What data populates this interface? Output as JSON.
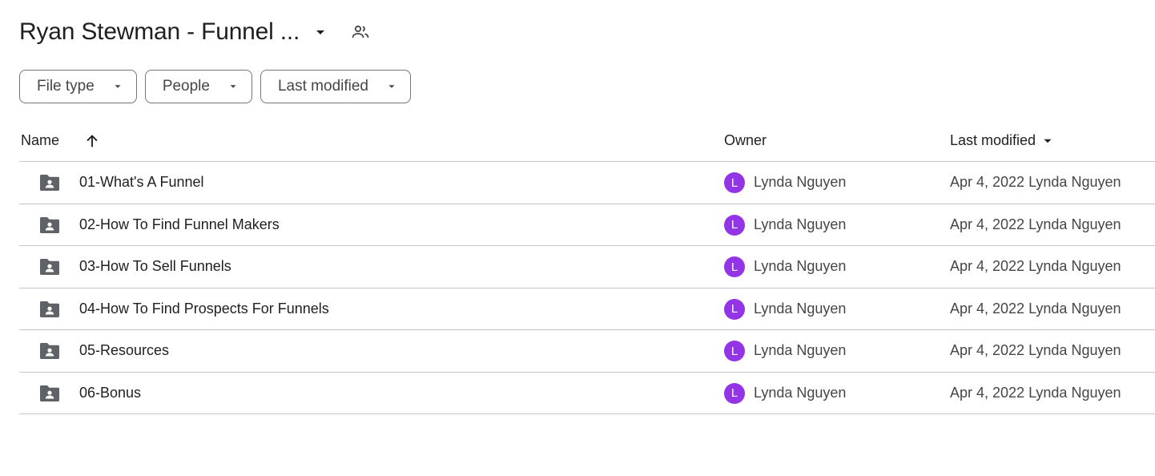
{
  "header": {
    "title": "Ryan Stewman - Funnel ...",
    "icons": {
      "caret": "arrow-drop-down-icon",
      "share": "people-icon"
    }
  },
  "filters": [
    {
      "label": "File type"
    },
    {
      "label": "People"
    },
    {
      "label": "Last modified"
    }
  ],
  "table": {
    "columns": {
      "name": "Name",
      "owner": "Owner",
      "modified": "Last modified"
    },
    "rows": [
      {
        "name": "01-What's A Funnel",
        "owner_initial": "L",
        "owner": "Lynda Nguyen",
        "modified": "Apr 4, 2022 Lynda Nguyen"
      },
      {
        "name": "02-How To Find Funnel Makers",
        "owner_initial": "L",
        "owner": "Lynda Nguyen",
        "modified": "Apr 4, 2022 Lynda Nguyen"
      },
      {
        "name": "03-How To Sell Funnels",
        "owner_initial": "L",
        "owner": "Lynda Nguyen",
        "modified": "Apr 4, 2022 Lynda Nguyen"
      },
      {
        "name": "04-How To Find Prospects For Funnels",
        "owner_initial": "L",
        "owner": "Lynda Nguyen",
        "modified": "Apr 4, 2022 Lynda Nguyen"
      },
      {
        "name": "05-Resources",
        "owner_initial": "L",
        "owner": "Lynda Nguyen",
        "modified": "Apr 4, 2022 Lynda Nguyen"
      },
      {
        "name": "06-Bonus",
        "owner_initial": "L",
        "owner": "Lynda Nguyen",
        "modified": "Apr 4, 2022 Lynda Nguyen"
      }
    ]
  },
  "colors": {
    "avatar": "#9334e6",
    "folder": "#5f6368",
    "divider": "#c7c7c7"
  }
}
